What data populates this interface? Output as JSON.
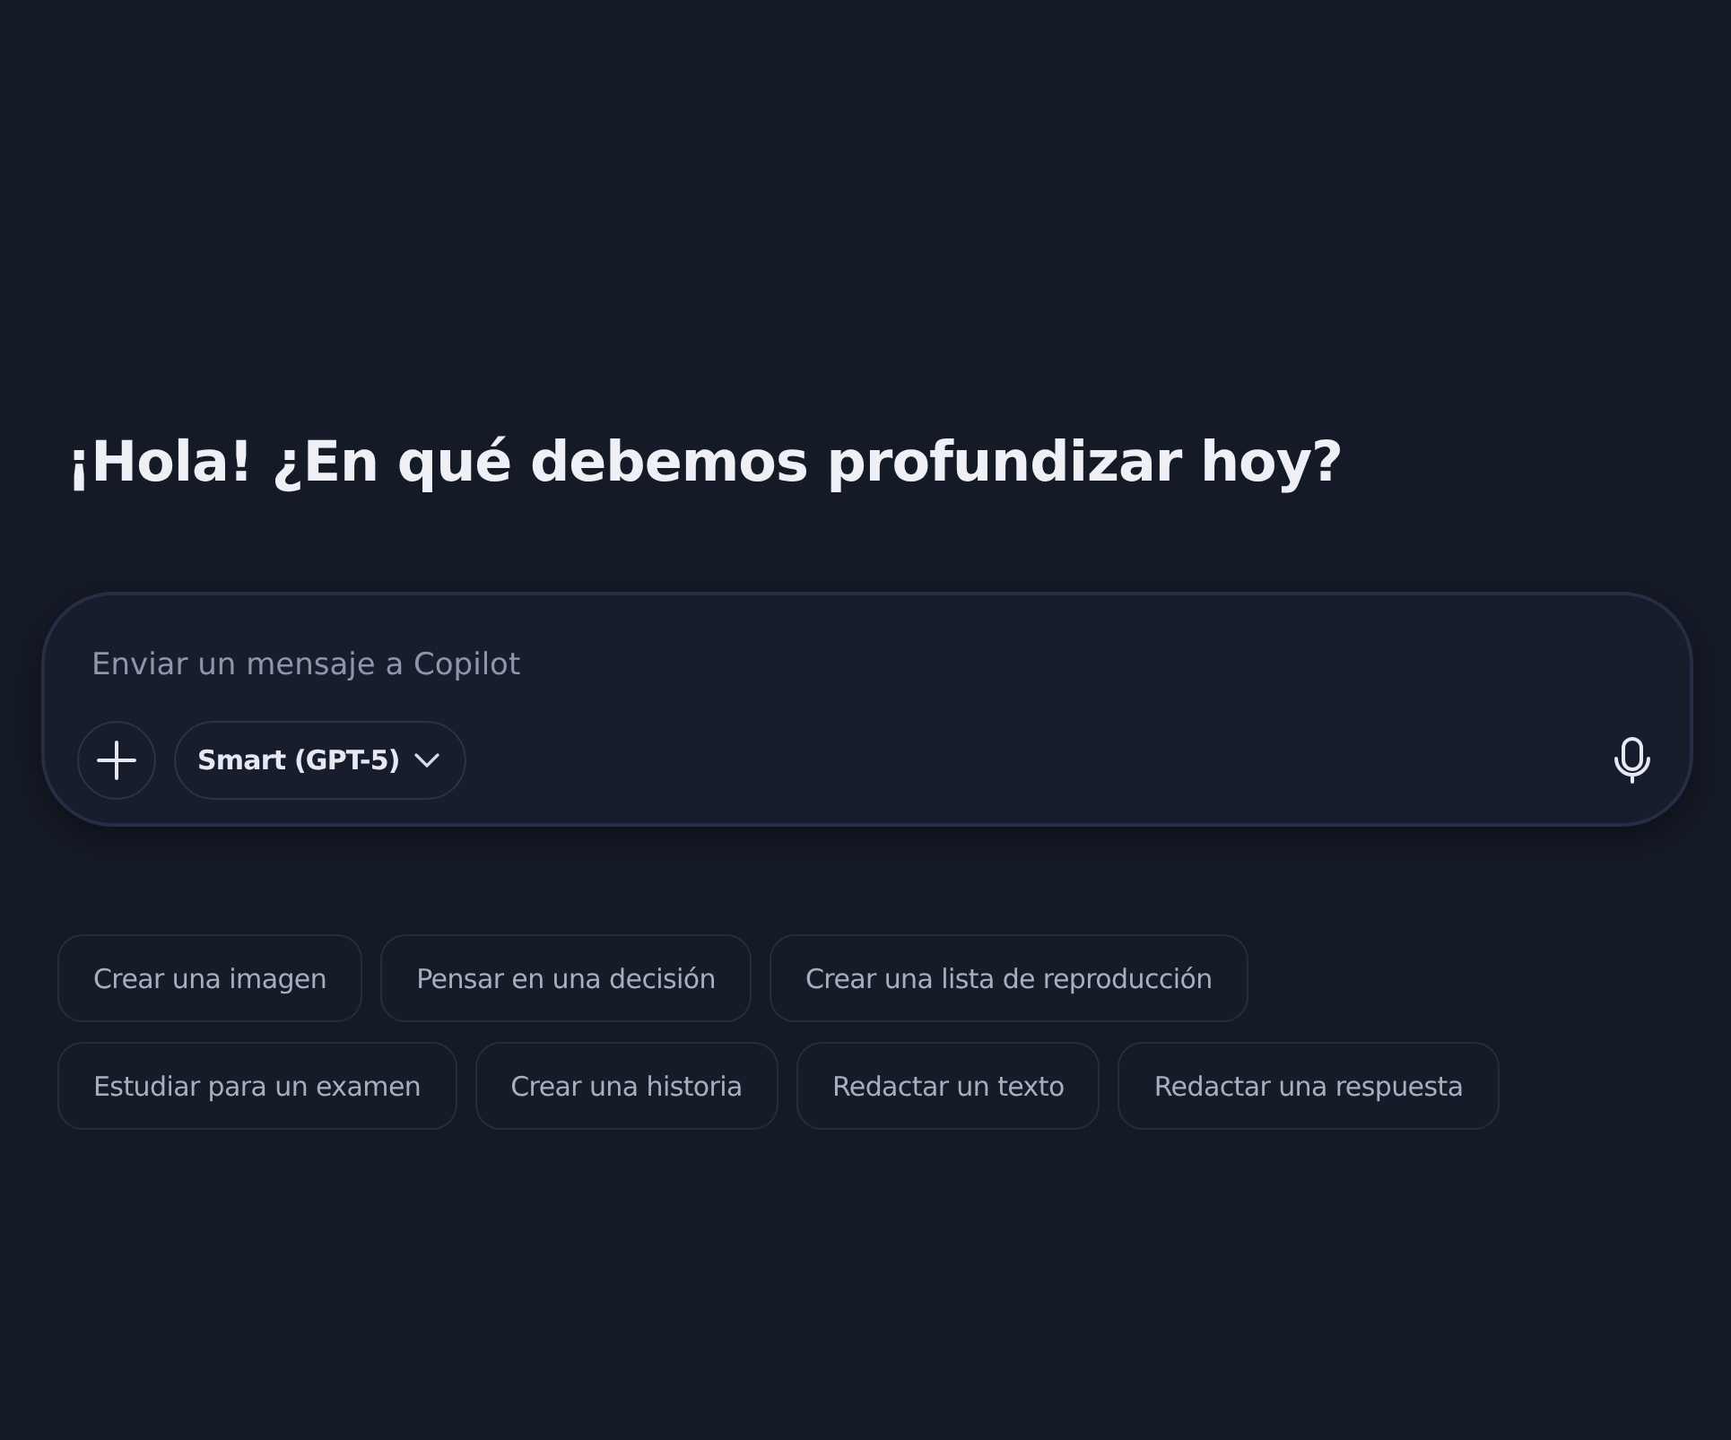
{
  "greeting": "¡Hola! ¿En qué debemos profundizar hoy?",
  "composer": {
    "placeholder": "Enviar un mensaje a Copilot",
    "model": "Smart (GPT-5)"
  },
  "suggestion_rows": [
    {
      "chips": [
        "Crear una imagen",
        "Pensar en una decisión",
        "Crear una lista de reproducción"
      ]
    },
    {
      "chips": [
        "Estudiar para un examen",
        "Crear una historia",
        "Redactar un texto",
        "Redactar una respuesta"
      ]
    }
  ]
}
